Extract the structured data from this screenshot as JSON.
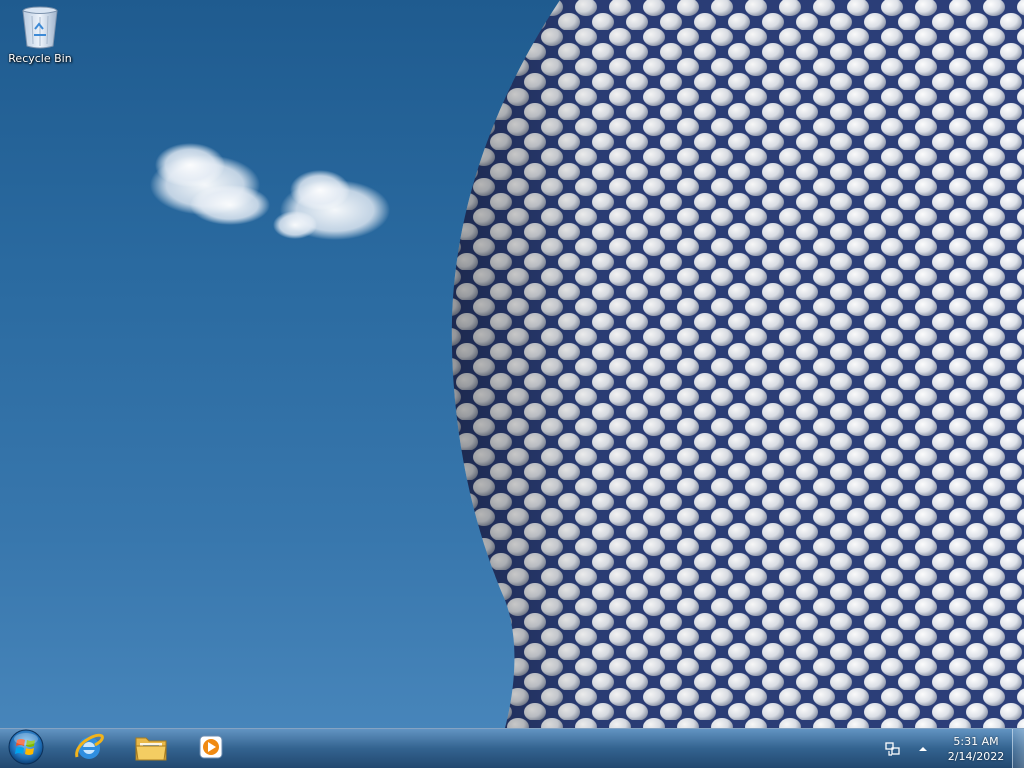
{
  "desktop": {
    "icons": [
      {
        "label": "Recycle Bin",
        "icon": "recycle-bin-icon"
      }
    ]
  },
  "taskbar": {
    "start": {
      "icon": "windows-logo-icon"
    },
    "pinned": [
      {
        "icon": "internet-explorer-icon"
      },
      {
        "icon": "folder-icon"
      },
      {
        "icon": "media-player-icon"
      }
    ],
    "tray": {
      "icons": [
        "network-icon",
        "chevron-up-icon"
      ],
      "time": "5:31 AM",
      "date": "2/14/2022"
    }
  },
  "colors": {
    "sky_top": "#1f5b8f",
    "sky_bottom": "#4a88bd",
    "building_disc": "#e6e8ec",
    "building_gap": "#2c3f7a"
  }
}
